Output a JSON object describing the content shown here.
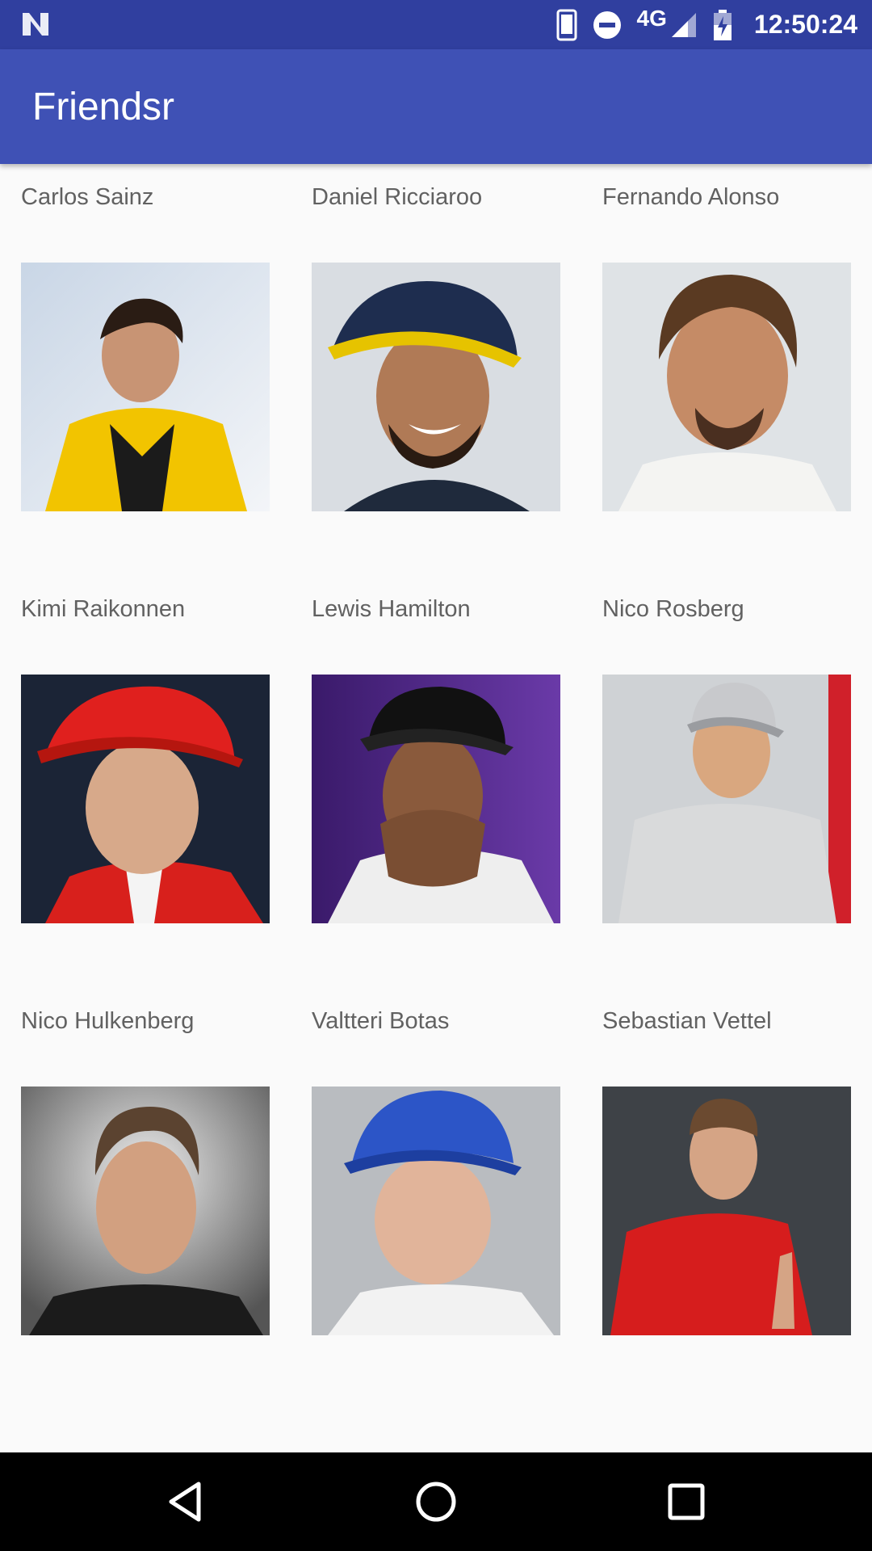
{
  "status_bar": {
    "network": "4G",
    "time": "12:50:24"
  },
  "app_bar": {
    "title": "Friendsr"
  },
  "friends": [
    {
      "name": "Carlos Sainz"
    },
    {
      "name": "Daniel Ricciaroo"
    },
    {
      "name": "Fernando Alonso"
    },
    {
      "name": "Kimi Raikonnen"
    },
    {
      "name": "Lewis Hamilton"
    },
    {
      "name": "Nico Rosberg"
    },
    {
      "name": "Nico Hulkenberg"
    },
    {
      "name": "Valtteri Botas"
    },
    {
      "name": "Sebastian Vettel"
    }
  ],
  "nav_bar": {
    "icons": [
      "back-icon",
      "home-icon",
      "recents-icon"
    ]
  }
}
